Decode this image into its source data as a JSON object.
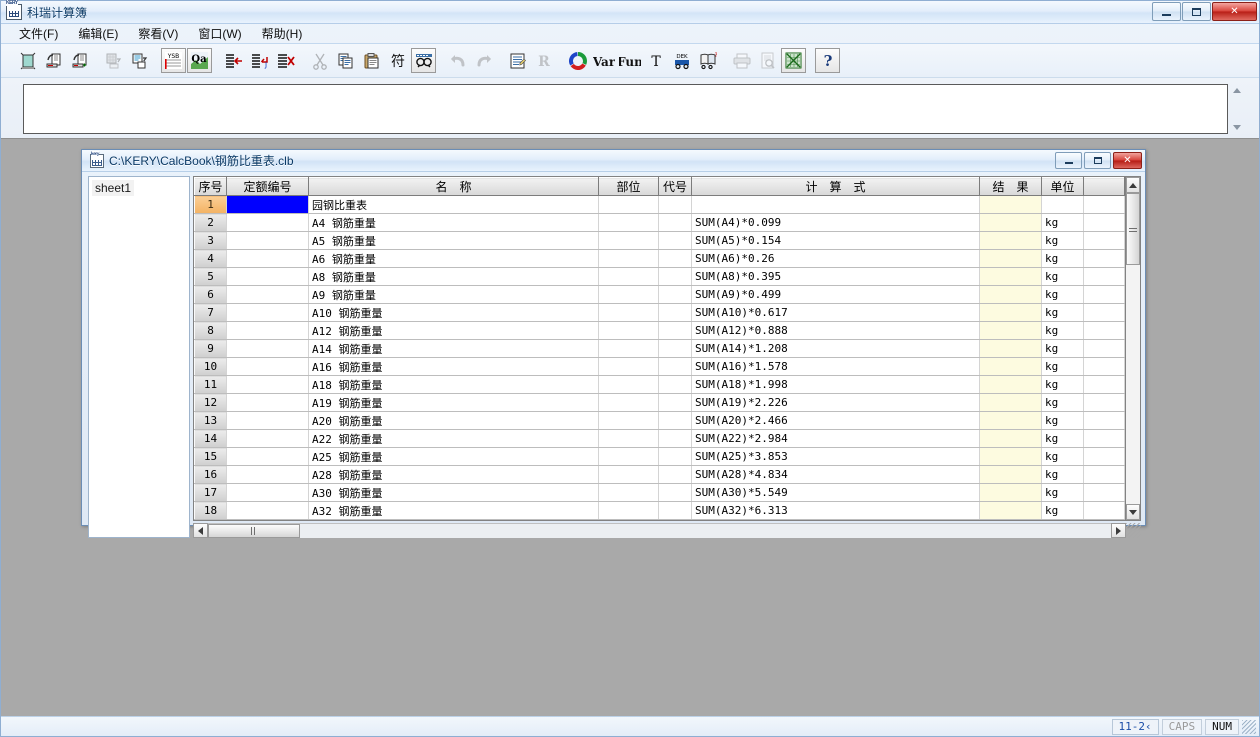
{
  "app": {
    "title": "科瑞计算簿",
    "icon": "kery-app-icon",
    "window_buttons": {
      "minimize": "minimize-icon",
      "maximize": "maximize-icon",
      "close": "✕"
    }
  },
  "menu": {
    "items": [
      {
        "label": "文件(F)",
        "name": "menu-file"
      },
      {
        "label": "编辑(E)",
        "name": "menu-edit"
      },
      {
        "label": "察看(V)",
        "name": "menu-view"
      },
      {
        "label": "窗口(W)",
        "name": "menu-window"
      },
      {
        "label": "帮助(H)",
        "name": "menu-help"
      }
    ]
  },
  "toolbar": {
    "buttons": [
      {
        "name": "new-document-icon",
        "label": "新建"
      },
      {
        "name": "open-document-icon",
        "label": "打开"
      },
      {
        "name": "add-document-icon",
        "label": "追加打开"
      },
      {
        "name": "save-grid-icon",
        "label": "保存"
      },
      {
        "name": "save-as-icon",
        "label": "另存为"
      },
      {
        "name": "ysb-quota-icon",
        "label": "YSB"
      },
      {
        "name": "qa-quota-icon",
        "label": "Qa"
      },
      {
        "name": "insert-row-icon",
        "label": "插入行"
      },
      {
        "name": "insert-row-below-icon",
        "label": "插入行下"
      },
      {
        "name": "delete-row-icon",
        "label": "删除行"
      },
      {
        "name": "cut-icon",
        "label": "剪切"
      },
      {
        "name": "copy-icon",
        "label": "复制"
      },
      {
        "name": "paste-icon",
        "label": "粘贴"
      },
      {
        "name": "symbol-icon",
        "label": "符"
      },
      {
        "name": "find-icon",
        "label": "查找"
      },
      {
        "name": "undo-icon",
        "label": "撤销"
      },
      {
        "name": "redo-icon",
        "label": "重做"
      },
      {
        "name": "note-icon",
        "label": "备注"
      },
      {
        "name": "r-register-icon",
        "label": "R"
      },
      {
        "name": "color-wheel-icon",
        "label": "颜色"
      },
      {
        "name": "var-icon",
        "label": "Var"
      },
      {
        "name": "fun-icon",
        "label": "Fun"
      },
      {
        "name": "text-icon",
        "label": "T"
      },
      {
        "name": "dek-icon",
        "label": "DEK"
      },
      {
        "name": "help-book-icon",
        "label": "手册"
      },
      {
        "name": "print-icon",
        "label": "打印"
      },
      {
        "name": "print-preview-icon",
        "label": "打印预览"
      },
      {
        "name": "excel-export-icon",
        "label": "导出Excel"
      },
      {
        "name": "about-help-icon",
        "label": "?"
      }
    ]
  },
  "edit_bar": {
    "value": "",
    "placeholder": "",
    "spin_up": "scroll-up-icon",
    "spin_down": "scroll-down-icon"
  },
  "child_window": {
    "title": "C:\\KERY\\CalcBook\\钢筋比重表.clb",
    "icon": "kery-doc-icon",
    "buttons": {
      "minimize": "minimize-icon",
      "maximize": "maximize-icon",
      "close": "✕"
    },
    "sheets": [
      {
        "label": "sheet1",
        "name": "sheet-item-sheet1",
        "selected": true
      }
    ],
    "grid": {
      "headers": [
        {
          "key": "rownum",
          "label": "序号"
        },
        {
          "key": "code",
          "label": "定额编号"
        },
        {
          "key": "name",
          "label": "名　称"
        },
        {
          "key": "part",
          "label": "部位"
        },
        {
          "key": "tag",
          "label": "代号"
        },
        {
          "key": "calc",
          "label": "计　算　式"
        },
        {
          "key": "result",
          "label": "结　果"
        },
        {
          "key": "unit",
          "label": "单位"
        },
        {
          "key": "tail",
          "label": ""
        }
      ],
      "rows": [
        {
          "rownum": "1",
          "code": "",
          "name": "园钢比重表",
          "part": "",
          "tag": "",
          "calc": "",
          "result": "",
          "unit": "",
          "current": true,
          "selected_col": "code"
        },
        {
          "rownum": "2",
          "code": "",
          "name": "A4 钢筋重量",
          "part": "",
          "tag": "",
          "calc": "SUM(A4)*0.099",
          "result": "",
          "unit": "kg"
        },
        {
          "rownum": "3",
          "code": "",
          "name": "A5 钢筋重量",
          "part": "",
          "tag": "",
          "calc": "SUM(A5)*0.154",
          "result": "",
          "unit": "kg"
        },
        {
          "rownum": "4",
          "code": "",
          "name": "A6 钢筋重量",
          "part": "",
          "tag": "",
          "calc": "SUM(A6)*0.26",
          "result": "",
          "unit": "kg"
        },
        {
          "rownum": "5",
          "code": "",
          "name": "A8 钢筋重量",
          "part": "",
          "tag": "",
          "calc": "SUM(A8)*0.395",
          "result": "",
          "unit": "kg"
        },
        {
          "rownum": "6",
          "code": "",
          "name": "A9 钢筋重量",
          "part": "",
          "tag": "",
          "calc": "SUM(A9)*0.499",
          "result": "",
          "unit": "kg"
        },
        {
          "rownum": "7",
          "code": "",
          "name": "A10 钢筋重量",
          "part": "",
          "tag": "",
          "calc": "SUM(A10)*0.617",
          "result": "",
          "unit": "kg"
        },
        {
          "rownum": "8",
          "code": "",
          "name": "A12 钢筋重量",
          "part": "",
          "tag": "",
          "calc": "SUM(A12)*0.888",
          "result": "",
          "unit": "kg"
        },
        {
          "rownum": "9",
          "code": "",
          "name": "A14 钢筋重量",
          "part": "",
          "tag": "",
          "calc": "SUM(A14)*1.208",
          "result": "",
          "unit": "kg"
        },
        {
          "rownum": "10",
          "code": "",
          "name": "A16 钢筋重量",
          "part": "",
          "tag": "",
          "calc": "SUM(A16)*1.578",
          "result": "",
          "unit": "kg"
        },
        {
          "rownum": "11",
          "code": "",
          "name": "A18 钢筋重量",
          "part": "",
          "tag": "",
          "calc": "SUM(A18)*1.998",
          "result": "",
          "unit": "kg"
        },
        {
          "rownum": "12",
          "code": "",
          "name": "A19 钢筋重量",
          "part": "",
          "tag": "",
          "calc": "SUM(A19)*2.226",
          "result": "",
          "unit": "kg"
        },
        {
          "rownum": "13",
          "code": "",
          "name": "A20 钢筋重量",
          "part": "",
          "tag": "",
          "calc": "SUM(A20)*2.466",
          "result": "",
          "unit": "kg"
        },
        {
          "rownum": "14",
          "code": "",
          "name": "A22 钢筋重量",
          "part": "",
          "tag": "",
          "calc": "SUM(A22)*2.984",
          "result": "",
          "unit": "kg"
        },
        {
          "rownum": "15",
          "code": "",
          "name": "A25 钢筋重量",
          "part": "",
          "tag": "",
          "calc": "SUM(A25)*3.853",
          "result": "",
          "unit": "kg"
        },
        {
          "rownum": "16",
          "code": "",
          "name": "A28 钢筋重量",
          "part": "",
          "tag": "",
          "calc": "SUM(A28)*4.834",
          "result": "",
          "unit": "kg"
        },
        {
          "rownum": "17",
          "code": "",
          "name": "A30 钢筋重量",
          "part": "",
          "tag": "",
          "calc": "SUM(A30)*5.549",
          "result": "",
          "unit": "kg"
        },
        {
          "rownum": "18",
          "code": "",
          "name": "A32 钢筋重量",
          "part": "",
          "tag": "",
          "calc": "SUM(A32)*6.313",
          "result": "",
          "unit": "kg"
        }
      ]
    }
  },
  "status_bar": {
    "coord": "11-2‹",
    "caps": "CAPS",
    "num": "NUM"
  },
  "colors": {
    "selection_blue": "#0000ff",
    "current_row_orange": "#f3b263",
    "result_cell": "#fdfbe0",
    "title_blue": "#0b3a66",
    "close_red": "#d6433a"
  }
}
